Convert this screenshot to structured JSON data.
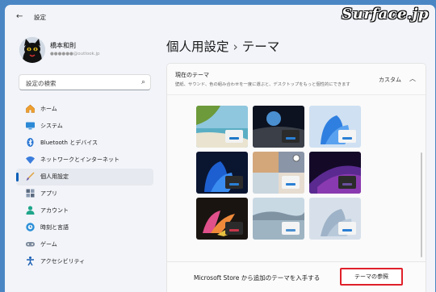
{
  "window": {
    "title": "設定",
    "back_glyph": "←"
  },
  "watermark": "Surface.jp",
  "user": {
    "name": "橋本和則",
    "email": "●●●●●●@outlook.jp"
  },
  "search": {
    "placeholder": "設定の検索"
  },
  "nav": [
    {
      "label": "ホーム",
      "icon": "home-icon"
    },
    {
      "label": "システム",
      "icon": "monitor-icon"
    },
    {
      "label": "Bluetooth とデバイス",
      "icon": "bluetooth-icon"
    },
    {
      "label": "ネットワークとインターネット",
      "icon": "wifi-icon"
    },
    {
      "label": "個人用設定",
      "icon": "brush-icon",
      "active": true
    },
    {
      "label": "アプリ",
      "icon": "apps-icon"
    },
    {
      "label": "アカウント",
      "icon": "person-icon"
    },
    {
      "label": "時刻と言語",
      "icon": "clock-globe-icon"
    },
    {
      "label": "ゲーム",
      "icon": "gamepad-icon"
    },
    {
      "label": "アクセシビリティ",
      "icon": "accessibility-icon"
    }
  ],
  "page": {
    "breadcrumb_parent": "個人用設定",
    "breadcrumb_sep": "›",
    "title": "テーマ"
  },
  "current_theme": {
    "title": "現在のテーマ",
    "description": "壁紙、サウンド、色の組み合わせを一度に選ぶと、デスクトップをもっと個性的にできます",
    "value": "カスタム",
    "chevron": "︿"
  },
  "themes": [
    {
      "name": "beach-theme",
      "bar": "#1e78c8"
    },
    {
      "name": "earth-theme",
      "bar": "#2a7fd4"
    },
    {
      "name": "windows-light-theme",
      "bar": "#2a7fd4"
    },
    {
      "name": "windows-dark-theme",
      "bar": "#2a7fd4"
    },
    {
      "name": "collage-theme",
      "bar": "#2a7fd4"
    },
    {
      "name": "glow-theme",
      "bar": "#6a4fa0"
    },
    {
      "name": "flower-theme",
      "bar": "#c8364a"
    },
    {
      "name": "lake-theme",
      "bar": "#4a8fd0"
    },
    {
      "name": "flow-theme",
      "bar": "#2a7fd4"
    }
  ],
  "store": {
    "text": "Microsoft Store から追加のテーマを入手する",
    "button": "テーマの参照"
  },
  "colors": {
    "accent": "#0a5fb8",
    "highlight": "#e0202a"
  }
}
